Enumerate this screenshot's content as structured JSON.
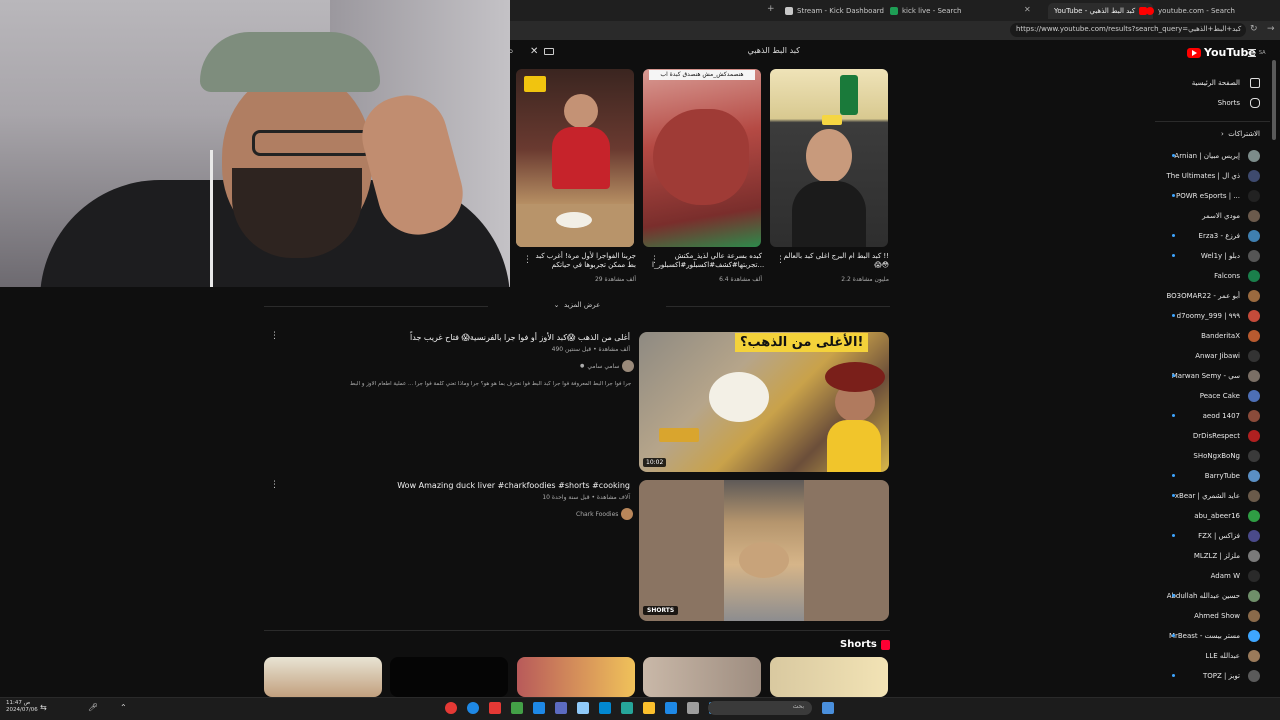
{
  "browser": {
    "tabs": [
      {
        "label": "Stream - Kick Dashboard",
        "fav": "#53fc18"
      },
      {
        "label": "kick live - Search",
        "fav": "#1e9e55"
      },
      {
        "label": "YouTube - كبد البط الذهبي",
        "fav": "#ff0000"
      },
      {
        "label": "youtube.com - Search",
        "fav": "#ff0000"
      }
    ],
    "address": "https://www.youtube.com/results?search_query=كبد+البط+الذهبي"
  },
  "youtube": {
    "logo": "YouTube",
    "logo_region": "SA",
    "search_query": "كبد البط الذهبي",
    "show_more": "عرض المزيد",
    "shorts_heading": "Shorts"
  },
  "top_shorts": [
    {
      "title": "كبد البط ام البرج اغلى كبد بالعالم !! 😱😳",
      "views": "2.2 مليون مشاهدة",
      "colors": [
        "#e9e3c9",
        "#3a3633"
      ]
    },
    {
      "title": "كبده بسرعة عالي لذيذ_مكتش تجربتها#كشف#اكسبلور#اكسبلور_ا...",
      "views": "6.4 ألف مشاهدة",
      "label": "هنصمدكش_مش هنصدق كبدة اب",
      "colors": [
        "#b94d47",
        "#6e3b3a"
      ]
    },
    {
      "title": "جربنا الفواجرا لأول مرة! أغرب كبد بط ممكن تجربوها في حياتكم",
      "views": "29 ألف مشاهدة",
      "colors": [
        "#b0342f",
        "#d8c6a0"
      ]
    }
  ],
  "results": [
    {
      "title": "أغلى من الذهب 😱كبد الأوز أو فوا جرا بالفرنسية😱 فتاح غريب جداً",
      "meta": "490 ألف مشاهدة • قبل سنتين",
      "channel": "سامي سامي",
      "desc": "كيف تصنع فطائر فوا جرا فوا جرا البط المعروفة فوا جرا كبد البط فوا نعترف بما هو هو؟ جرا وماذا تعني كلمة فوا جرا ... عملية اطعام الاوز و البط",
      "duration": "10:02",
      "banner": "الأغلى من الذهب؟!"
    },
    {
      "title": "Wow Amazing duck liver #charkfoodies #shorts #cooking",
      "meta": "10 آلاف مشاهدة • قبل سنة واحدة",
      "channel": "Chark Foodies",
      "badge": "SHORTS"
    }
  ],
  "sidebar": {
    "nav": [
      {
        "label": "الصفحة الرئيسية",
        "icon": "home-icon"
      },
      {
        "label": "Shorts",
        "icon": "shorts-icon"
      }
    ],
    "subs_heading": "الاشتراكات",
    "channels": [
      {
        "name": "Arnian | إيريس مبيان",
        "color": "#7c8c8a",
        "live": true
      },
      {
        "name": "The Ultimates | ذي ال",
        "color": "#3e4a6e",
        "live": false
      },
      {
        "name": "POWR eSports | ...",
        "color": "#222222",
        "live": true
      },
      {
        "name": "مودي الاسمر",
        "color": "#6b5a4c",
        "live": false
      },
      {
        "name": "Erza3 - فرزع",
        "color": "#3f7fb0",
        "live": true
      },
      {
        "name": "Wel1y | دبلو",
        "color": "#555555",
        "live": true
      },
      {
        "name": "Falcons",
        "color": "#1a7f4b",
        "live": false
      },
      {
        "name": "BO3OMAR22 - أبو عمر",
        "color": "#9a6a3f",
        "live": false
      },
      {
        "name": "d7oomy_999 | ٩٩٩",
        "color": "#c44b3a",
        "live": true
      },
      {
        "name": "BanderitaX",
        "color": "#b85a2f",
        "live": false
      },
      {
        "name": "Anwar Jibawi",
        "color": "#333333",
        "live": false
      },
      {
        "name": "Marwan Semy - سي",
        "color": "#7a6f65",
        "live": true
      },
      {
        "name": "Peace Cake",
        "color": "#4d6fb5",
        "live": false
      },
      {
        "name": "aeod 1407",
        "color": "#8a4b3a",
        "live": true
      },
      {
        "name": "DrDisRespect",
        "color": "#b02020",
        "live": false
      },
      {
        "name": "SHoNgxBoNg",
        "color": "#3a3a3a",
        "live": false
      },
      {
        "name": "BarryTube",
        "color": "#5a8fc4",
        "live": true
      },
      {
        "name": "xBear | عايد الشمري",
        "color": "#6a5a4a",
        "live": true
      },
      {
        "name": "abu_abeer16",
        "color": "#2f9e44",
        "live": false
      },
      {
        "name": "FZX | فزاكس",
        "color": "#4a4a8a",
        "live": true
      },
      {
        "name": "MLZLZ | ملزلز",
        "color": "#7a7a7a",
        "live": false
      },
      {
        "name": "Adam W",
        "color": "#2a2a2a",
        "live": false
      },
      {
        "name": "Abdullah حسين عبدالله",
        "color": "#6f8f6a",
        "live": true
      },
      {
        "name": "Ahmed Show",
        "color": "#8a6a4a",
        "live": false
      },
      {
        "name": "MrBeast - مستر بيست",
        "color": "#3ea6ff",
        "live": true
      },
      {
        "name": "LLE عبدالله",
        "color": "#9a7a5a",
        "live": false
      },
      {
        "name": "TOPZ | توبز",
        "color": "#5a5a5a",
        "live": true
      }
    ]
  },
  "taskbar": {
    "search_placeholder": "بحث",
    "clock": "11:47 ص",
    "date": "2024/07/06",
    "icons": [
      "#e53935",
      "#1e88e5",
      "#e53935",
      "#43a047",
      "#1e88e5",
      "#5c6bc0",
      "#90caf9",
      "#0288d1",
      "#26a69a",
      "#fbc02d",
      "#1e88e5",
      "#9e9e9e",
      "#42a5f5"
    ]
  }
}
